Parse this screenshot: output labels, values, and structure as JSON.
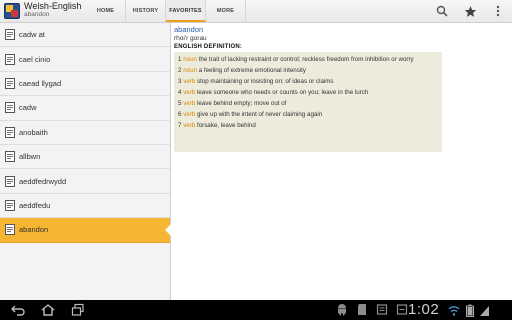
{
  "app": {
    "title": "Welsh-English",
    "subtitle": "abandon",
    "icon": "dictionary-app-icon"
  },
  "tabs": [
    {
      "label": "HOME",
      "active": false
    },
    {
      "label": "HISTORY",
      "active": false
    },
    {
      "label": "FAVORITES",
      "active": true
    },
    {
      "label": "MORE",
      "active": false
    }
  ],
  "actions": [
    {
      "name": "search-icon"
    },
    {
      "name": "star-icon"
    },
    {
      "name": "overflow-menu-icon"
    }
  ],
  "word_list": [
    {
      "word": "cadw at",
      "selected": false
    },
    {
      "word": "cael cinio",
      "selected": false
    },
    {
      "word": "caead llygad",
      "selected": false
    },
    {
      "word": "cadw",
      "selected": false
    },
    {
      "word": "anobaith",
      "selected": false
    },
    {
      "word": "allbwn",
      "selected": false
    },
    {
      "word": "aeddfedrwydd",
      "selected": false
    },
    {
      "word": "aeddfedu",
      "selected": false
    },
    {
      "word": "abandon",
      "selected": true
    }
  ],
  "detail": {
    "headword": "abandon",
    "translation": "rhoi'r gorau",
    "definition_heading": "ENGLISH DEFINITION:",
    "definitions": [
      {
        "num": "1",
        "pos": "noun",
        "text": "the trait of lacking restraint or control; reckless freedom from inhibition or worry"
      },
      {
        "num": "2",
        "pos": "noun",
        "text": "a feeling of extreme emotional intensity"
      },
      {
        "num": "3",
        "pos": "verb",
        "text": "stop maintaining or insisting on; of ideas or claims"
      },
      {
        "num": "4",
        "pos": "verb",
        "text": "leave someone who needs or counts on you; leave in the lurch"
      },
      {
        "num": "5",
        "pos": "verb",
        "text": "leave behind empty; move out of"
      },
      {
        "num": "6",
        "pos": "verb",
        "text": "give up with the intent of never claiming again"
      },
      {
        "num": "7",
        "pos": "verb",
        "text": "forsake, leave behind"
      }
    ]
  },
  "system_bar": {
    "time": "1:02",
    "nav": [
      "back-icon",
      "home-icon",
      "recent-apps-icon"
    ],
    "status": [
      "android-debug-icon",
      "sd-card-icon",
      "notification-icon",
      "notification-icon-2"
    ]
  },
  "colors": {
    "accent": "#f6b533",
    "headword": "#2a60a8",
    "part_of_speech": "#e08a00",
    "definition_bg": "#ecebdc"
  }
}
